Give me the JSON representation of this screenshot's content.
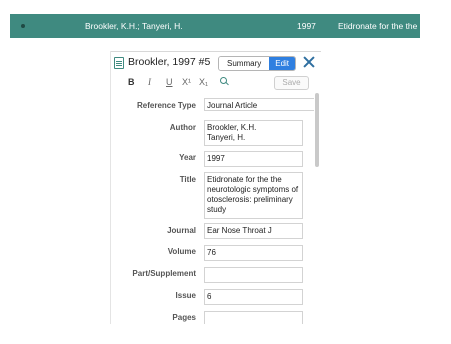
{
  "list_row": {
    "author": "Brookler, K.H.; Tanyeri, H.",
    "year": "1997",
    "title": "Etidronate for the the"
  },
  "reference": {
    "header_title": "Brookler, 1997  #5",
    "tabs": {
      "summary": "Summary",
      "edit": "Edit"
    },
    "toolbar": {
      "bold": "B",
      "italic": "I",
      "underline": "U",
      "superscript": "X¹",
      "subscript": "X₁",
      "save": "Save"
    },
    "fields": {
      "reference_type": {
        "label": "Reference Type",
        "value": "Journal Article"
      },
      "author": {
        "label": "Author",
        "lines": [
          "Brookler, K.H.",
          "Tanyeri, H."
        ]
      },
      "year": {
        "label": "Year",
        "value": "1997"
      },
      "title": {
        "label": "Title",
        "lines": [
          "Etidronate for the the",
          "neurotologic symptoms of",
          "otosclerosis: preliminary",
          "study"
        ]
      },
      "journal": {
        "label": "Journal",
        "value": "Ear Nose Throat J"
      },
      "volume": {
        "label": "Volume",
        "value": "76"
      },
      "part_supplement": {
        "label": "Part/Supplement",
        "value": ""
      },
      "issue": {
        "label": "Issue",
        "value": "6"
      },
      "pages": {
        "label": "Pages",
        "value": ""
      }
    }
  },
  "colors": {
    "selection": "#3f8a80",
    "accent_blue": "#2f7fe0"
  },
  "icons": {
    "doc": "document-icon",
    "search": "search-icon",
    "close": "close-icon"
  }
}
